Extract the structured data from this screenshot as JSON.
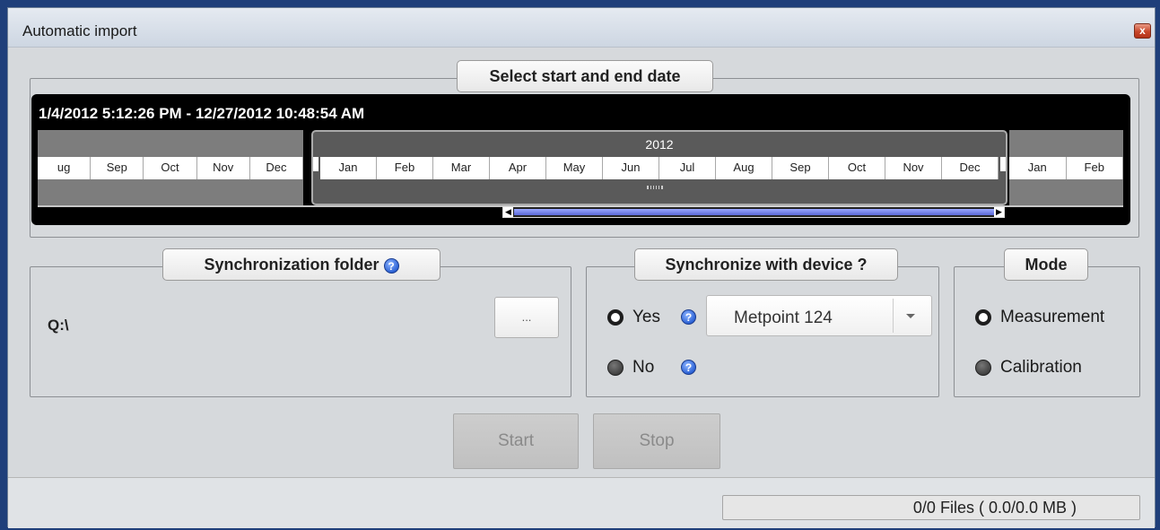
{
  "window": {
    "title": "Automatic import",
    "close_label": "x"
  },
  "date_section": {
    "legend": "Select start and end date",
    "range_text": "1/4/2012 5:12:26 PM  -  12/27/2012 10:48:54 AM",
    "year": "2012",
    "left_months": [
      "ug",
      "Sep",
      "Oct",
      "Nov",
      "Dec"
    ],
    "mid_months": [
      "Jan",
      "Feb",
      "Mar",
      "Apr",
      "May",
      "Jun",
      "Jul",
      "Aug",
      "Sep",
      "Oct",
      "Nov",
      "Dec"
    ],
    "right_months": [
      "Jan",
      "Feb"
    ]
  },
  "sync_folder": {
    "legend": "Synchronization folder",
    "path": "Q:\\",
    "browse_label": "..."
  },
  "sync_device": {
    "legend": "Synchronize with device ?",
    "yes_label": "Yes",
    "no_label": "No",
    "selected": "Yes",
    "device_value": "Metpoint 124"
  },
  "mode": {
    "legend": "Mode",
    "options": [
      "Measurement",
      "Calibration"
    ],
    "selected": "Measurement"
  },
  "actions": {
    "start_label": "Start",
    "stop_label": "Stop"
  },
  "status": {
    "files_text": "0/0 Files  ( 0.0/0.0 MB  )"
  },
  "icons": {
    "help": "help-icon",
    "close": "close-icon",
    "dropdown": "chevron-down-icon"
  },
  "colors": {
    "timeline_bg": "#000000",
    "scroll_accent": "#5b68d8",
    "help_blue": "#2d63d6",
    "close_red": "#c8472a"
  }
}
